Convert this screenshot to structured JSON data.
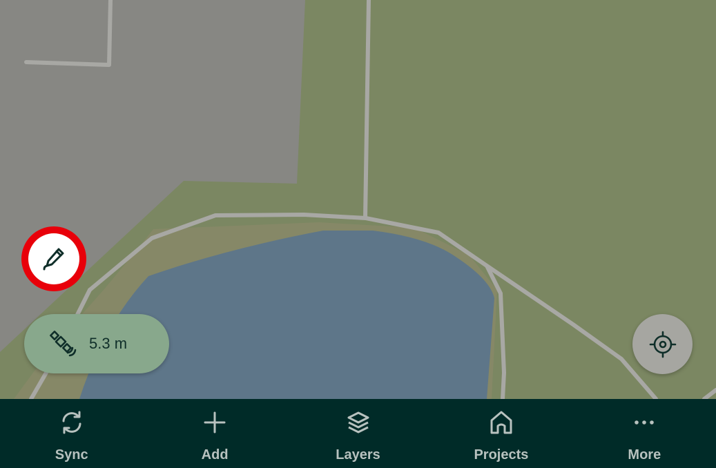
{
  "map": {
    "colors": {
      "urban": "#878783",
      "green": "#7b8762",
      "sand": "#868867",
      "water": "#5e7689",
      "road": "#a8a8a4"
    }
  },
  "edit_button": {
    "icon": "pencil-icon",
    "ring_color": "#e8000a"
  },
  "gps_indicator": {
    "icon": "satellite-icon",
    "accuracy": "5.3 m"
  },
  "locate_button": {
    "icon": "crosshair-icon"
  },
  "bottom_nav": {
    "items": [
      {
        "label": "Sync",
        "icon": "sync-icon"
      },
      {
        "label": "Add",
        "icon": "plus-icon"
      },
      {
        "label": "Layers",
        "icon": "layers-icon"
      },
      {
        "label": "Projects",
        "icon": "home-icon"
      },
      {
        "label": "More",
        "icon": "more-icon"
      }
    ]
  }
}
